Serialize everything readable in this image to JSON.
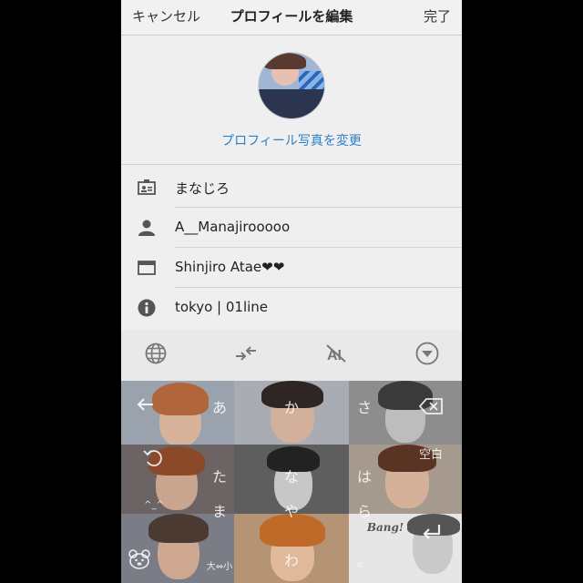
{
  "navbar": {
    "cancel_label": "キャンセル",
    "title": "プロフィールを編集",
    "done_label": "完了"
  },
  "profile": {
    "change_photo_label": "プロフィール写真を変更"
  },
  "fields": [
    {
      "icon": "id-card-icon",
      "value": "まなじろ"
    },
    {
      "icon": "user-icon",
      "value": "A__Manajirooooo"
    },
    {
      "icon": "website-icon",
      "value": "Shinjiro Atae❤❤"
    },
    {
      "icon": "info-icon",
      "value": "tokyo | 01line"
    }
  ],
  "keyboard_toolbar": {
    "icons": [
      "globe-icon",
      "swap-icon",
      "ai-off-icon",
      "collapse-icon"
    ]
  },
  "keyboard": {
    "keys": {
      "a": "あ",
      "ka": "か",
      "sa": "さ",
      "ta": "た",
      "na": "な",
      "ha": "は",
      "space": "空白",
      "ma": "ま",
      "ra": "ら",
      "ya": "や",
      "wa": "わ",
      "kaomoji": "^_^",
      "dakuten": "大⇔小",
      "punct": "。"
    },
    "sticker_text": "Bang!"
  },
  "colors": {
    "accent": "#2d7fc9",
    "background": "#efefef",
    "frame": "#000000"
  }
}
